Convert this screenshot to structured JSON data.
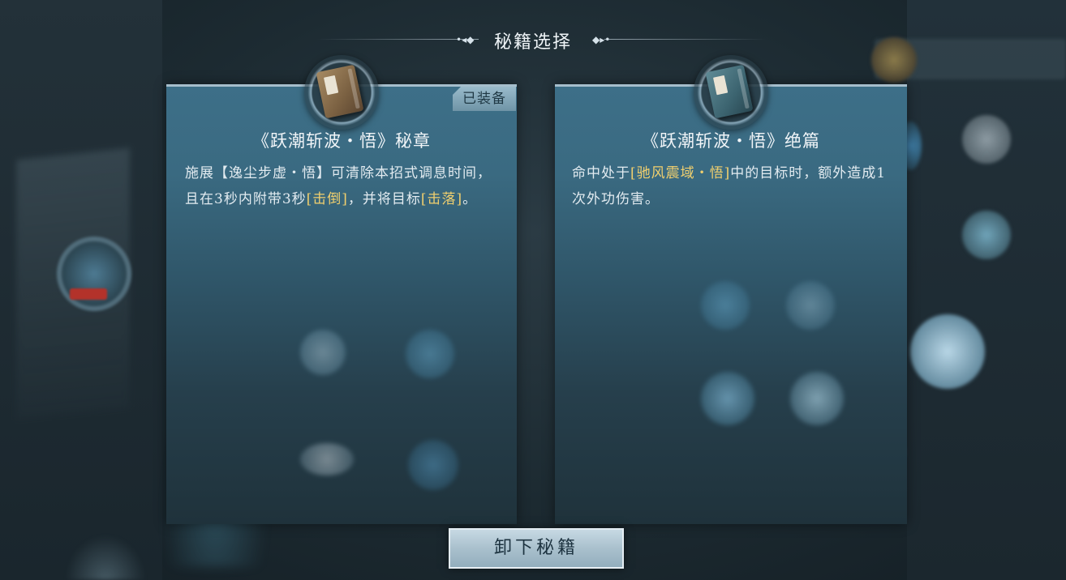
{
  "header": {
    "title": "秘籍选择"
  },
  "cards": [
    {
      "title": "《跃潮斩波・悟》秘章",
      "status_badge": "已装备",
      "book_color": "brown",
      "desc": {
        "p1": "施展【逸尘步虚・悟】可清除本招式调息时间，且在3秒内附带3秒",
        "h1": "[击倒]",
        "p2": "，并将目标",
        "h2": "[击落]",
        "p3": "。"
      }
    },
    {
      "title": "《跃潮斩波・悟》绝篇",
      "book_color": "teal",
      "desc": {
        "p1": "命中处于",
        "h1": "[驰风震域・悟]",
        "p2": "中的目标时，额外造成1次外功伤害。"
      }
    }
  ],
  "footer": {
    "unload_button": "卸下秘籍"
  },
  "colors": {
    "highlight": "#f0cf6e",
    "panel_top": "#3d6f88",
    "button": "#a9c0cd"
  }
}
